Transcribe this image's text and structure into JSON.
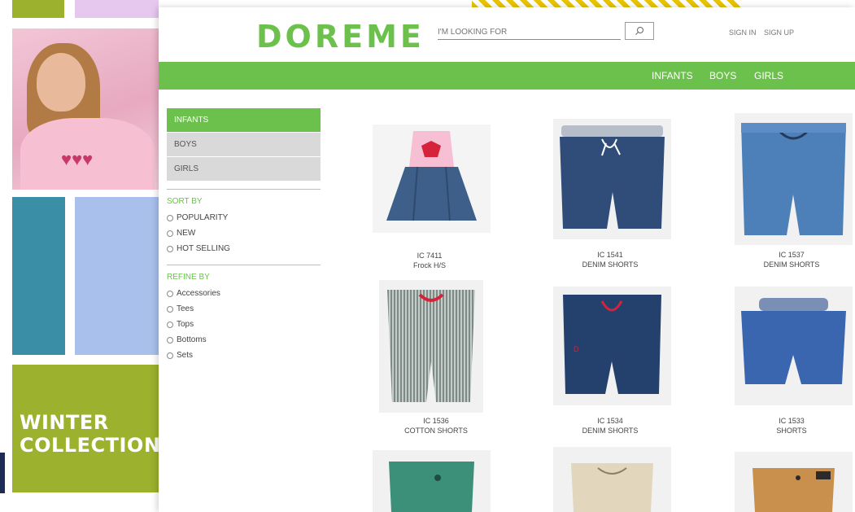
{
  "brand": {
    "logo": "DOREME",
    "accent": "#6cc14d"
  },
  "background": {
    "collection_line1": "WINTER",
    "collection_line2": "COLLECTION",
    "colors": [
      "#9cb12d",
      "#3a8ea6",
      "#a9c0ec",
      "#e6c8ef"
    ]
  },
  "search": {
    "placeholder": "I'M LOOKING FOR",
    "icon": "search-icon"
  },
  "auth": {
    "sign_in": "SIGN IN",
    "sign_up": "SIGN UP"
  },
  "nav": {
    "items": [
      "INFANTS",
      "BOYS",
      "GIRLS"
    ]
  },
  "sidebar": {
    "categories": [
      {
        "label": "INFANTS",
        "active": true
      },
      {
        "label": "BOYS",
        "active": false
      },
      {
        "label": "GIRLS",
        "active": false
      }
    ],
    "sort_heading": "SORT BY",
    "sort_options": [
      "POPULARITY",
      "NEW",
      "HOT SELLING"
    ],
    "refine_heading": "REFINE BY",
    "refine_options": [
      "Accessories",
      "Tees",
      "Tops",
      "Bottoms",
      "Sets"
    ]
  },
  "products": [
    {
      "code": "IC 7411",
      "name": "Frock H/S"
    },
    {
      "code": "IC 1541",
      "name": "DENIM SHORTS"
    },
    {
      "code": "IC 1537",
      "name": "DENIM SHORTS"
    },
    {
      "code": "IC 1536",
      "name": "COTTON SHORTS"
    },
    {
      "code": "IC 1534",
      "name": "DENIM SHORTS"
    },
    {
      "code": "IC 1533",
      "name": "SHORTS"
    }
  ]
}
